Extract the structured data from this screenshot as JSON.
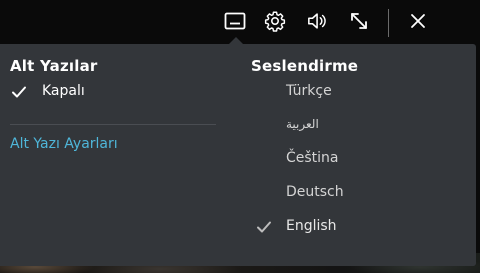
{
  "controls": {
    "subtitles_icon": "subtitles-icon",
    "settings_icon": "gear-icon",
    "volume_icon": "speaker-icon",
    "fullscreen_icon": "expand-icon",
    "close_icon": "close-icon"
  },
  "subtitles": {
    "heading": "Alt Yazılar",
    "options": [
      {
        "label": "Kapalı",
        "selected": true
      }
    ],
    "settings_link": "Alt Yazı Ayarları"
  },
  "audio": {
    "heading": "Seslendirme",
    "options": [
      {
        "label": "Türkçe",
        "selected": false
      },
      {
        "label": "العربية",
        "selected": false
      },
      {
        "label": "Čeština",
        "selected": false
      },
      {
        "label": "Deutsch",
        "selected": false
      },
      {
        "label": "English",
        "selected": true
      }
    ]
  },
  "colors": {
    "panel": "#33363a",
    "link": "#4fb6d9",
    "text": "#ffffff"
  }
}
